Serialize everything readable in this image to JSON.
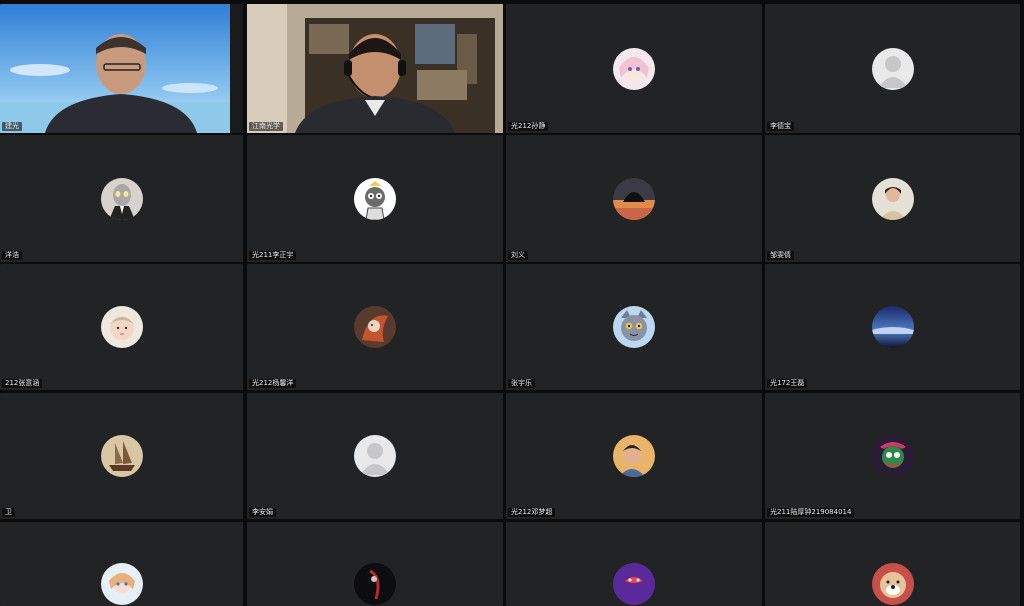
{
  "participants": [
    {
      "name": "建光",
      "type": "video",
      "scene": "sea"
    },
    {
      "name": "江南光学",
      "type": "video",
      "scene": "office",
      "active": true
    },
    {
      "name": "光212孙静",
      "type": "avatar",
      "avatar": "anime-girl-avatar"
    },
    {
      "name": "李德宝",
      "type": "avatar",
      "avatar": "default-user-avatar"
    },
    {
      "name": "洋浩",
      "type": "avatar",
      "avatar": "ultraman-avatar"
    },
    {
      "name": "光211李正宇",
      "type": "avatar",
      "avatar": "cartoon-cat-avatar"
    },
    {
      "name": "刘义",
      "type": "avatar",
      "avatar": "sunset-tree-avatar"
    },
    {
      "name": "邹雯倩",
      "type": "avatar",
      "avatar": "portrait-avatar"
    },
    {
      "name": "212张意涵",
      "type": "avatar",
      "avatar": "baby-avatar"
    },
    {
      "name": "光212杨馨洋",
      "type": "avatar",
      "avatar": "red-fox-avatar"
    },
    {
      "name": "张宇乐",
      "type": "avatar",
      "avatar": "gray-cat-avatar"
    },
    {
      "name": "光172王磊",
      "type": "avatar",
      "avatar": "night-sky-avatar"
    },
    {
      "name": "卫",
      "type": "avatar",
      "avatar": "sailing-ship-avatar"
    },
    {
      "name": "李安娟",
      "type": "avatar",
      "avatar": "default-user-avatar"
    },
    {
      "name": "光212邓梦超",
      "type": "avatar",
      "avatar": "boy-photo-avatar"
    },
    {
      "name": "光211陆厚钟219084014",
      "type": "avatar",
      "avatar": "clown-avatar"
    },
    {
      "name": "",
      "type": "avatar",
      "avatar": "anime-avatar"
    },
    {
      "name": "",
      "type": "avatar",
      "avatar": "dark-figure-avatar"
    },
    {
      "name": "",
      "type": "avatar",
      "avatar": "purple-ghost-avatar"
    },
    {
      "name": "",
      "type": "avatar",
      "avatar": "dog-avatar"
    }
  ],
  "colors": {
    "background": "#0b0b0c",
    "tile": "#222325",
    "active_border": "#49c16a"
  }
}
